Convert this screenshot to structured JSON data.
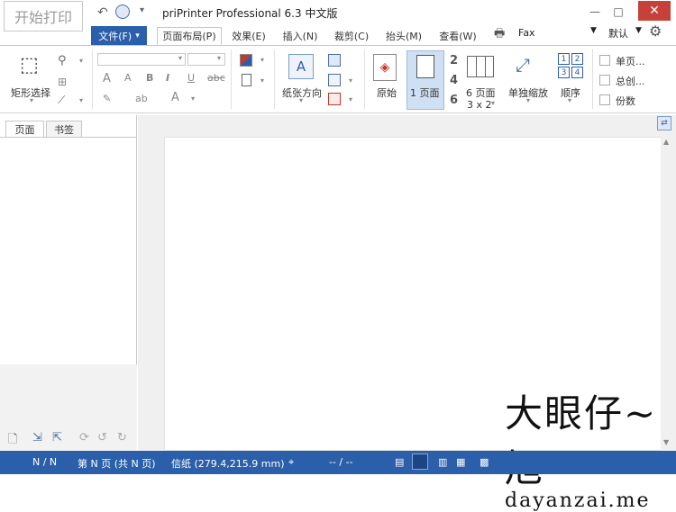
{
  "title_bar": {
    "print_button": "开始打印",
    "title": "priPrinter Professional 6.3 中文版"
  },
  "tabs": {
    "file": "文件(F)",
    "items": [
      "页面布局(P)",
      "效果(E)",
      "插入(N)",
      "裁剪(C)",
      "抬头(M)",
      "查看(W)"
    ]
  },
  "printer": {
    "name": "Fax",
    "preset": "默认"
  },
  "ribbon": {
    "rect_select": "矩形选择",
    "paper_orientation": "纸张方向",
    "original": "原始",
    "one_page": "1 页面",
    "num2": "2",
    "num4": "4",
    "num6": "6",
    "six_pages": "6 页面",
    "grid": "3 x 2",
    "individual_scale": "单独缩放",
    "order": "顺序",
    "single_page": "单页...",
    "collate": "总创...",
    "copies": "份数",
    "grid_nums": [
      "1",
      "2",
      "3",
      "4"
    ]
  },
  "left_panel": {
    "tab_pages": "页面",
    "tab_bookmarks": "书签"
  },
  "status_bar": {
    "pos": "N / N",
    "page_info": "第 N 页 (共 N 页)",
    "paper": "信纸 (279.4,215.9 mm)",
    "coords": "-- / --"
  },
  "watermark": {
    "line1": "大眼仔~旭",
    "line2": "dayanzai.me"
  }
}
